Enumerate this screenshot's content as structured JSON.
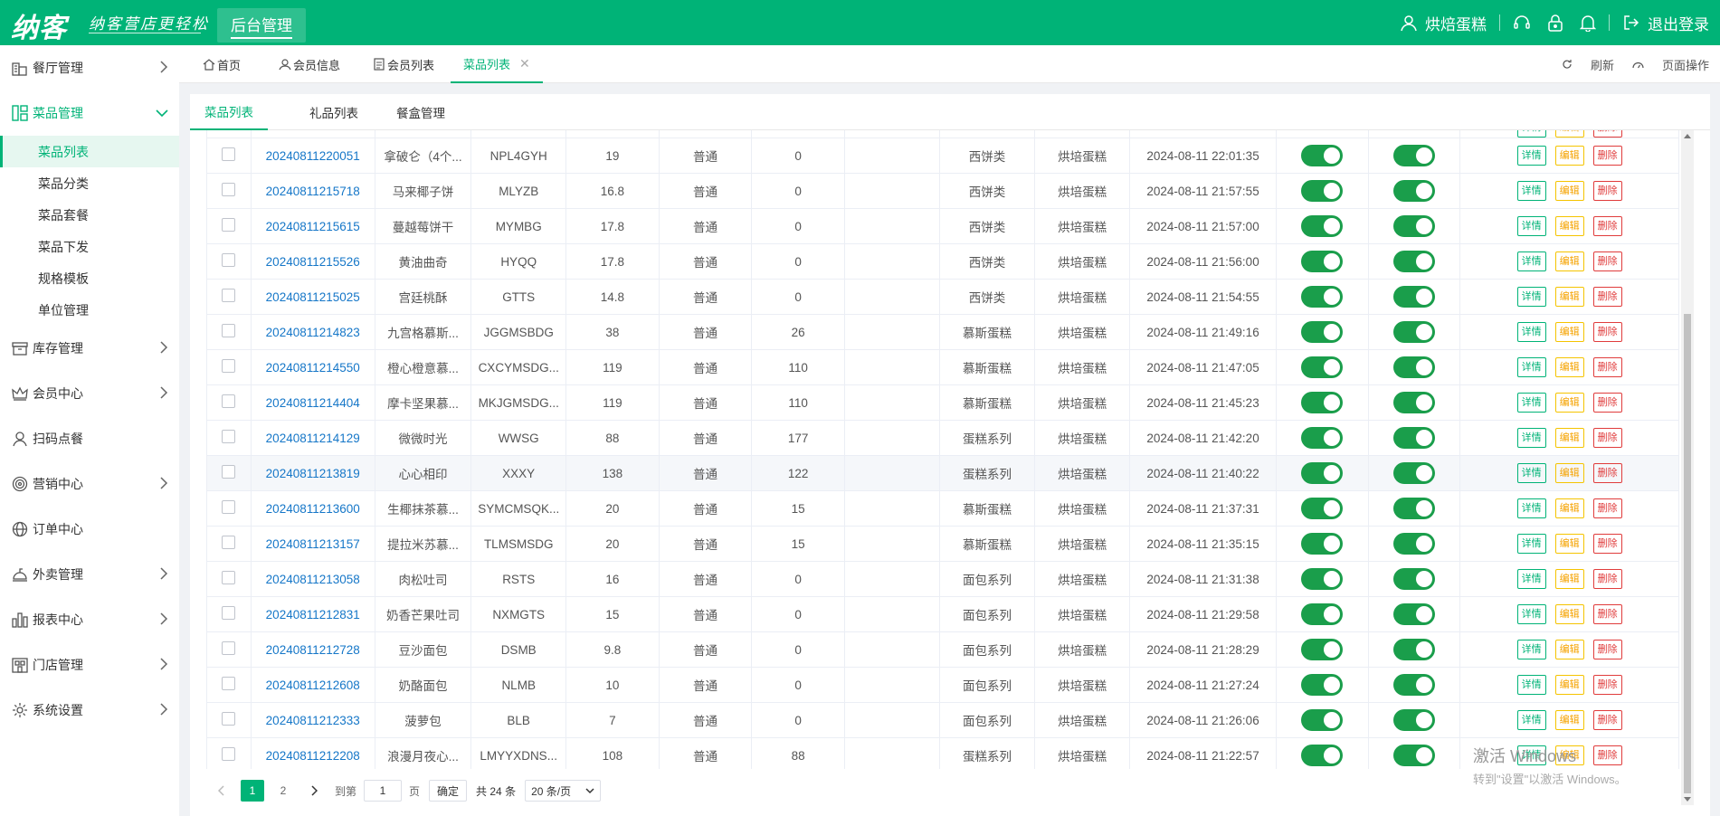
{
  "header": {
    "logo": "纳客",
    "slogan": "纳客营店更轻松",
    "mgmt_label": "后台管理",
    "store_name": "烘焙蛋糕",
    "logout": "退出登录"
  },
  "sidebar": {
    "items": [
      {
        "label": "餐厅管理",
        "icon": "restaurant-icon"
      },
      {
        "label": "菜品管理",
        "icon": "dish-icon",
        "expanded": true
      },
      {
        "label": "库存管理",
        "icon": "inventory-icon"
      },
      {
        "label": "会员中心",
        "icon": "crown-icon"
      },
      {
        "label": "扫码点餐",
        "icon": "user-icon"
      },
      {
        "label": "营销中心",
        "icon": "target-icon"
      },
      {
        "label": "订单中心",
        "icon": "globe-icon"
      },
      {
        "label": "外卖管理",
        "icon": "delivery-icon"
      },
      {
        "label": "报表中心",
        "icon": "report-icon"
      },
      {
        "label": "门店管理",
        "icon": "store-icon"
      },
      {
        "label": "系统设置",
        "icon": "gear-icon"
      }
    ],
    "dish_subitems": [
      "菜品列表",
      "菜品分类",
      "菜品套餐",
      "菜品下发",
      "规格模板",
      "单位管理"
    ]
  },
  "tags": {
    "home": "首页",
    "member_info": "会员信息",
    "member_list": "会员列表",
    "dish_list": "菜品列表",
    "refresh": "刷新",
    "page_ops": "页面操作"
  },
  "subtabs": [
    "菜品列表",
    "礼品列表",
    "餐盒管理"
  ],
  "table": {
    "actions": {
      "detail": "详情",
      "edit": "编辑",
      "delete": "删除"
    },
    "rows": [
      {
        "no": "20240811220051",
        "name": "拿破仑（4个...",
        "code": "NPL4GYH",
        "price": "19",
        "type": "普通",
        "stock": "0",
        "category": "西饼类",
        "store": "烘培蛋糕",
        "time": "2024-08-11 22:01:35"
      },
      {
        "no": "20240811215718",
        "name": "马来椰子饼",
        "code": "MLYZB",
        "price": "16.8",
        "type": "普通",
        "stock": "0",
        "category": "西饼类",
        "store": "烘培蛋糕",
        "time": "2024-08-11 21:57:55"
      },
      {
        "no": "20240811215615",
        "name": "蔓越莓饼干",
        "code": "MYMBG",
        "price": "17.8",
        "type": "普通",
        "stock": "0",
        "category": "西饼类",
        "store": "烘培蛋糕",
        "time": "2024-08-11 21:57:00"
      },
      {
        "no": "20240811215526",
        "name": "黄油曲奇",
        "code": "HYQQ",
        "price": "17.8",
        "type": "普通",
        "stock": "0",
        "category": "西饼类",
        "store": "烘培蛋糕",
        "time": "2024-08-11 21:56:00"
      },
      {
        "no": "20240811215025",
        "name": "宫廷桃酥",
        "code": "GTTS",
        "price": "14.8",
        "type": "普通",
        "stock": "0",
        "category": "西饼类",
        "store": "烘培蛋糕",
        "time": "2024-08-11 21:54:55"
      },
      {
        "no": "20240811214823",
        "name": "九宫格慕斯...",
        "code": "JGGMSBDG",
        "price": "38",
        "type": "普通",
        "stock": "26",
        "category": "慕斯蛋糕",
        "store": "烘培蛋糕",
        "time": "2024-08-11 21:49:16"
      },
      {
        "no": "20240811214550",
        "name": "橙心橙意慕...",
        "code": "CXCYMSDG...",
        "price": "119",
        "type": "普通",
        "stock": "110",
        "category": "慕斯蛋糕",
        "store": "烘培蛋糕",
        "time": "2024-08-11 21:47:05"
      },
      {
        "no": "20240811214404",
        "name": "摩卡坚果慕...",
        "code": "MKJGMSDG...",
        "price": "119",
        "type": "普通",
        "stock": "110",
        "category": "慕斯蛋糕",
        "store": "烘培蛋糕",
        "time": "2024-08-11 21:45:23"
      },
      {
        "no": "20240811214129",
        "name": "微微时光",
        "code": "WWSG",
        "price": "88",
        "type": "普通",
        "stock": "177",
        "category": "蛋糕系列",
        "store": "烘培蛋糕",
        "time": "2024-08-11 21:42:20"
      },
      {
        "no": "20240811213819",
        "name": "心心相印",
        "code": "XXXY",
        "price": "138",
        "type": "普通",
        "stock": "122",
        "category": "蛋糕系列",
        "store": "烘培蛋糕",
        "time": "2024-08-11 21:40:22",
        "highlight": true
      },
      {
        "no": "20240811213600",
        "name": "生椰抹茶慕...",
        "code": "SYMCMSQK...",
        "price": "20",
        "type": "普通",
        "stock": "15",
        "category": "慕斯蛋糕",
        "store": "烘培蛋糕",
        "time": "2024-08-11 21:37:31"
      },
      {
        "no": "20240811213157",
        "name": "提拉米苏慕...",
        "code": "TLMSMSDG",
        "price": "20",
        "type": "普通",
        "stock": "15",
        "category": "慕斯蛋糕",
        "store": "烘培蛋糕",
        "time": "2024-08-11 21:35:15"
      },
      {
        "no": "20240811213058",
        "name": "肉松吐司",
        "code": "RSTS",
        "price": "16",
        "type": "普通",
        "stock": "0",
        "category": "面包系列",
        "store": "烘培蛋糕",
        "time": "2024-08-11 21:31:38"
      },
      {
        "no": "20240811212831",
        "name": "奶香芒果吐司",
        "code": "NXMGTS",
        "price": "15",
        "type": "普通",
        "stock": "0",
        "category": "面包系列",
        "store": "烘培蛋糕",
        "time": "2024-08-11 21:29:58"
      },
      {
        "no": "20240811212728",
        "name": "豆沙面包",
        "code": "DSMB",
        "price": "9.8",
        "type": "普通",
        "stock": "0",
        "category": "面包系列",
        "store": "烘培蛋糕",
        "time": "2024-08-11 21:28:29"
      },
      {
        "no": "20240811212608",
        "name": "奶酪面包",
        "code": "NLMB",
        "price": "10",
        "type": "普通",
        "stock": "0",
        "category": "面包系列",
        "store": "烘培蛋糕",
        "time": "2024-08-11 21:27:24"
      },
      {
        "no": "20240811212333",
        "name": "菠萝包",
        "code": "BLB",
        "price": "7",
        "type": "普通",
        "stock": "0",
        "category": "面包系列",
        "store": "烘培蛋糕",
        "time": "2024-08-11 21:26:06"
      },
      {
        "no": "20240811212208",
        "name": "浪漫月夜心...",
        "code": "LMYYXDNS...",
        "price": "108",
        "type": "普通",
        "stock": "88",
        "category": "蛋糕系列",
        "store": "烘培蛋糕",
        "time": "2024-08-11 21:22:57"
      }
    ]
  },
  "pagination": {
    "current": "1",
    "page2": "2",
    "goto_label": "到第",
    "goto_value": "1",
    "page_unit": "页",
    "confirm": "确定",
    "total": "共 24 条",
    "page_size": "20 条/页"
  },
  "watermark": {
    "line1": "激活 Windows",
    "line2": "转到\"设置\"以激活 Windows。"
  },
  "colors": {
    "brand": "#00b377",
    "switch_on": "#1a9e4b",
    "link": "#1677c8"
  }
}
